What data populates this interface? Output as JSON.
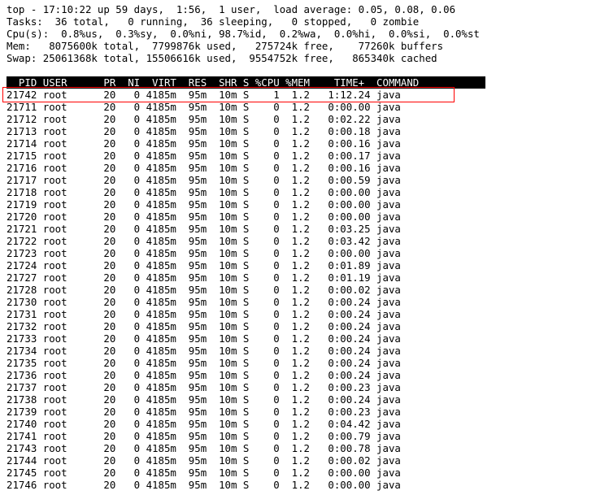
{
  "header": {
    "line1": "top - 17:10:22 up 59 days,  1:56,  1 user,  load average: 0.05, 0.08, 0.06",
    "line2": "Tasks:  36 total,   0 running,  36 sleeping,   0 stopped,   0 zombie",
    "line3": "Cpu(s):  0.8%us,  0.3%sy,  0.0%ni, 98.7%id,  0.2%wa,  0.0%hi,  0.0%si,  0.0%st",
    "line4": "Mem:   8075600k total,  7799876k used,   275724k free,    77260k buffers",
    "line5": "Swap: 25061368k total, 15506616k used,  9554752k free,   865340k cached"
  },
  "columns": "  PID USER      PR  NI  VIRT  RES  SHR S %CPU %MEM    TIME+  COMMAND           ",
  "processes": [
    {
      "pid": "21742",
      "user": "root",
      "pr": "20",
      "ni": "0",
      "virt": "4185m",
      "res": "95m",
      "shr": "10m",
      "s": "S",
      "cpu": "1",
      "mem": "1.2",
      "time": "1:12.24",
      "cmd": "java",
      "highlight": true
    },
    {
      "pid": "21711",
      "user": "root",
      "pr": "20",
      "ni": "0",
      "virt": "4185m",
      "res": "95m",
      "shr": "10m",
      "s": "S",
      "cpu": "0",
      "mem": "1.2",
      "time": "0:00.00",
      "cmd": "java"
    },
    {
      "pid": "21712",
      "user": "root",
      "pr": "20",
      "ni": "0",
      "virt": "4185m",
      "res": "95m",
      "shr": "10m",
      "s": "S",
      "cpu": "0",
      "mem": "1.2",
      "time": "0:02.22",
      "cmd": "java"
    },
    {
      "pid": "21713",
      "user": "root",
      "pr": "20",
      "ni": "0",
      "virt": "4185m",
      "res": "95m",
      "shr": "10m",
      "s": "S",
      "cpu": "0",
      "mem": "1.2",
      "time": "0:00.18",
      "cmd": "java"
    },
    {
      "pid": "21714",
      "user": "root",
      "pr": "20",
      "ni": "0",
      "virt": "4185m",
      "res": "95m",
      "shr": "10m",
      "s": "S",
      "cpu": "0",
      "mem": "1.2",
      "time": "0:00.16",
      "cmd": "java"
    },
    {
      "pid": "21715",
      "user": "root",
      "pr": "20",
      "ni": "0",
      "virt": "4185m",
      "res": "95m",
      "shr": "10m",
      "s": "S",
      "cpu": "0",
      "mem": "1.2",
      "time": "0:00.17",
      "cmd": "java"
    },
    {
      "pid": "21716",
      "user": "root",
      "pr": "20",
      "ni": "0",
      "virt": "4185m",
      "res": "95m",
      "shr": "10m",
      "s": "S",
      "cpu": "0",
      "mem": "1.2",
      "time": "0:00.16",
      "cmd": "java"
    },
    {
      "pid": "21717",
      "user": "root",
      "pr": "20",
      "ni": "0",
      "virt": "4185m",
      "res": "95m",
      "shr": "10m",
      "s": "S",
      "cpu": "0",
      "mem": "1.2",
      "time": "0:00.59",
      "cmd": "java"
    },
    {
      "pid": "21718",
      "user": "root",
      "pr": "20",
      "ni": "0",
      "virt": "4185m",
      "res": "95m",
      "shr": "10m",
      "s": "S",
      "cpu": "0",
      "mem": "1.2",
      "time": "0:00.00",
      "cmd": "java"
    },
    {
      "pid": "21719",
      "user": "root",
      "pr": "20",
      "ni": "0",
      "virt": "4185m",
      "res": "95m",
      "shr": "10m",
      "s": "S",
      "cpu": "0",
      "mem": "1.2",
      "time": "0:00.00",
      "cmd": "java"
    },
    {
      "pid": "21720",
      "user": "root",
      "pr": "20",
      "ni": "0",
      "virt": "4185m",
      "res": "95m",
      "shr": "10m",
      "s": "S",
      "cpu": "0",
      "mem": "1.2",
      "time": "0:00.00",
      "cmd": "java"
    },
    {
      "pid": "21721",
      "user": "root",
      "pr": "20",
      "ni": "0",
      "virt": "4185m",
      "res": "95m",
      "shr": "10m",
      "s": "S",
      "cpu": "0",
      "mem": "1.2",
      "time": "0:03.25",
      "cmd": "java"
    },
    {
      "pid": "21722",
      "user": "root",
      "pr": "20",
      "ni": "0",
      "virt": "4185m",
      "res": "95m",
      "shr": "10m",
      "s": "S",
      "cpu": "0",
      "mem": "1.2",
      "time": "0:03.42",
      "cmd": "java"
    },
    {
      "pid": "21723",
      "user": "root",
      "pr": "20",
      "ni": "0",
      "virt": "4185m",
      "res": "95m",
      "shr": "10m",
      "s": "S",
      "cpu": "0",
      "mem": "1.2",
      "time": "0:00.00",
      "cmd": "java"
    },
    {
      "pid": "21724",
      "user": "root",
      "pr": "20",
      "ni": "0",
      "virt": "4185m",
      "res": "95m",
      "shr": "10m",
      "s": "S",
      "cpu": "0",
      "mem": "1.2",
      "time": "0:01.89",
      "cmd": "java"
    },
    {
      "pid": "21727",
      "user": "root",
      "pr": "20",
      "ni": "0",
      "virt": "4185m",
      "res": "95m",
      "shr": "10m",
      "s": "S",
      "cpu": "0",
      "mem": "1.2",
      "time": "0:01.19",
      "cmd": "java"
    },
    {
      "pid": "21728",
      "user": "root",
      "pr": "20",
      "ni": "0",
      "virt": "4185m",
      "res": "95m",
      "shr": "10m",
      "s": "S",
      "cpu": "0",
      "mem": "1.2",
      "time": "0:00.02",
      "cmd": "java"
    },
    {
      "pid": "21730",
      "user": "root",
      "pr": "20",
      "ni": "0",
      "virt": "4185m",
      "res": "95m",
      "shr": "10m",
      "s": "S",
      "cpu": "0",
      "mem": "1.2",
      "time": "0:00.24",
      "cmd": "java"
    },
    {
      "pid": "21731",
      "user": "root",
      "pr": "20",
      "ni": "0",
      "virt": "4185m",
      "res": "95m",
      "shr": "10m",
      "s": "S",
      "cpu": "0",
      "mem": "1.2",
      "time": "0:00.24",
      "cmd": "java"
    },
    {
      "pid": "21732",
      "user": "root",
      "pr": "20",
      "ni": "0",
      "virt": "4185m",
      "res": "95m",
      "shr": "10m",
      "s": "S",
      "cpu": "0",
      "mem": "1.2",
      "time": "0:00.24",
      "cmd": "java"
    },
    {
      "pid": "21733",
      "user": "root",
      "pr": "20",
      "ni": "0",
      "virt": "4185m",
      "res": "95m",
      "shr": "10m",
      "s": "S",
      "cpu": "0",
      "mem": "1.2",
      "time": "0:00.24",
      "cmd": "java"
    },
    {
      "pid": "21734",
      "user": "root",
      "pr": "20",
      "ni": "0",
      "virt": "4185m",
      "res": "95m",
      "shr": "10m",
      "s": "S",
      "cpu": "0",
      "mem": "1.2",
      "time": "0:00.24",
      "cmd": "java"
    },
    {
      "pid": "21735",
      "user": "root",
      "pr": "20",
      "ni": "0",
      "virt": "4185m",
      "res": "95m",
      "shr": "10m",
      "s": "S",
      "cpu": "0",
      "mem": "1.2",
      "time": "0:00.24",
      "cmd": "java"
    },
    {
      "pid": "21736",
      "user": "root",
      "pr": "20",
      "ni": "0",
      "virt": "4185m",
      "res": "95m",
      "shr": "10m",
      "s": "S",
      "cpu": "0",
      "mem": "1.2",
      "time": "0:00.24",
      "cmd": "java"
    },
    {
      "pid": "21737",
      "user": "root",
      "pr": "20",
      "ni": "0",
      "virt": "4185m",
      "res": "95m",
      "shr": "10m",
      "s": "S",
      "cpu": "0",
      "mem": "1.2",
      "time": "0:00.23",
      "cmd": "java"
    },
    {
      "pid": "21738",
      "user": "root",
      "pr": "20",
      "ni": "0",
      "virt": "4185m",
      "res": "95m",
      "shr": "10m",
      "s": "S",
      "cpu": "0",
      "mem": "1.2",
      "time": "0:00.24",
      "cmd": "java"
    },
    {
      "pid": "21739",
      "user": "root",
      "pr": "20",
      "ni": "0",
      "virt": "4185m",
      "res": "95m",
      "shr": "10m",
      "s": "S",
      "cpu": "0",
      "mem": "1.2",
      "time": "0:00.23",
      "cmd": "java"
    },
    {
      "pid": "21740",
      "user": "root",
      "pr": "20",
      "ni": "0",
      "virt": "4185m",
      "res": "95m",
      "shr": "10m",
      "s": "S",
      "cpu": "0",
      "mem": "1.2",
      "time": "0:04.42",
      "cmd": "java"
    },
    {
      "pid": "21741",
      "user": "root",
      "pr": "20",
      "ni": "0",
      "virt": "4185m",
      "res": "95m",
      "shr": "10m",
      "s": "S",
      "cpu": "0",
      "mem": "1.2",
      "time": "0:00.79",
      "cmd": "java"
    },
    {
      "pid": "21743",
      "user": "root",
      "pr": "20",
      "ni": "0",
      "virt": "4185m",
      "res": "95m",
      "shr": "10m",
      "s": "S",
      "cpu": "0",
      "mem": "1.2",
      "time": "0:00.78",
      "cmd": "java"
    },
    {
      "pid": "21744",
      "user": "root",
      "pr": "20",
      "ni": "0",
      "virt": "4185m",
      "res": "95m",
      "shr": "10m",
      "s": "S",
      "cpu": "0",
      "mem": "1.2",
      "time": "0:00.02",
      "cmd": "java"
    },
    {
      "pid": "21745",
      "user": "root",
      "pr": "20",
      "ni": "0",
      "virt": "4185m",
      "res": "95m",
      "shr": "10m",
      "s": "S",
      "cpu": "0",
      "mem": "1.2",
      "time": "0:00.00",
      "cmd": "java"
    },
    {
      "pid": "21746",
      "user": "root",
      "pr": "20",
      "ni": "0",
      "virt": "4185m",
      "res": "95m",
      "shr": "10m",
      "s": "S",
      "cpu": "0",
      "mem": "1.2",
      "time": "0:00.00",
      "cmd": "java"
    }
  ]
}
